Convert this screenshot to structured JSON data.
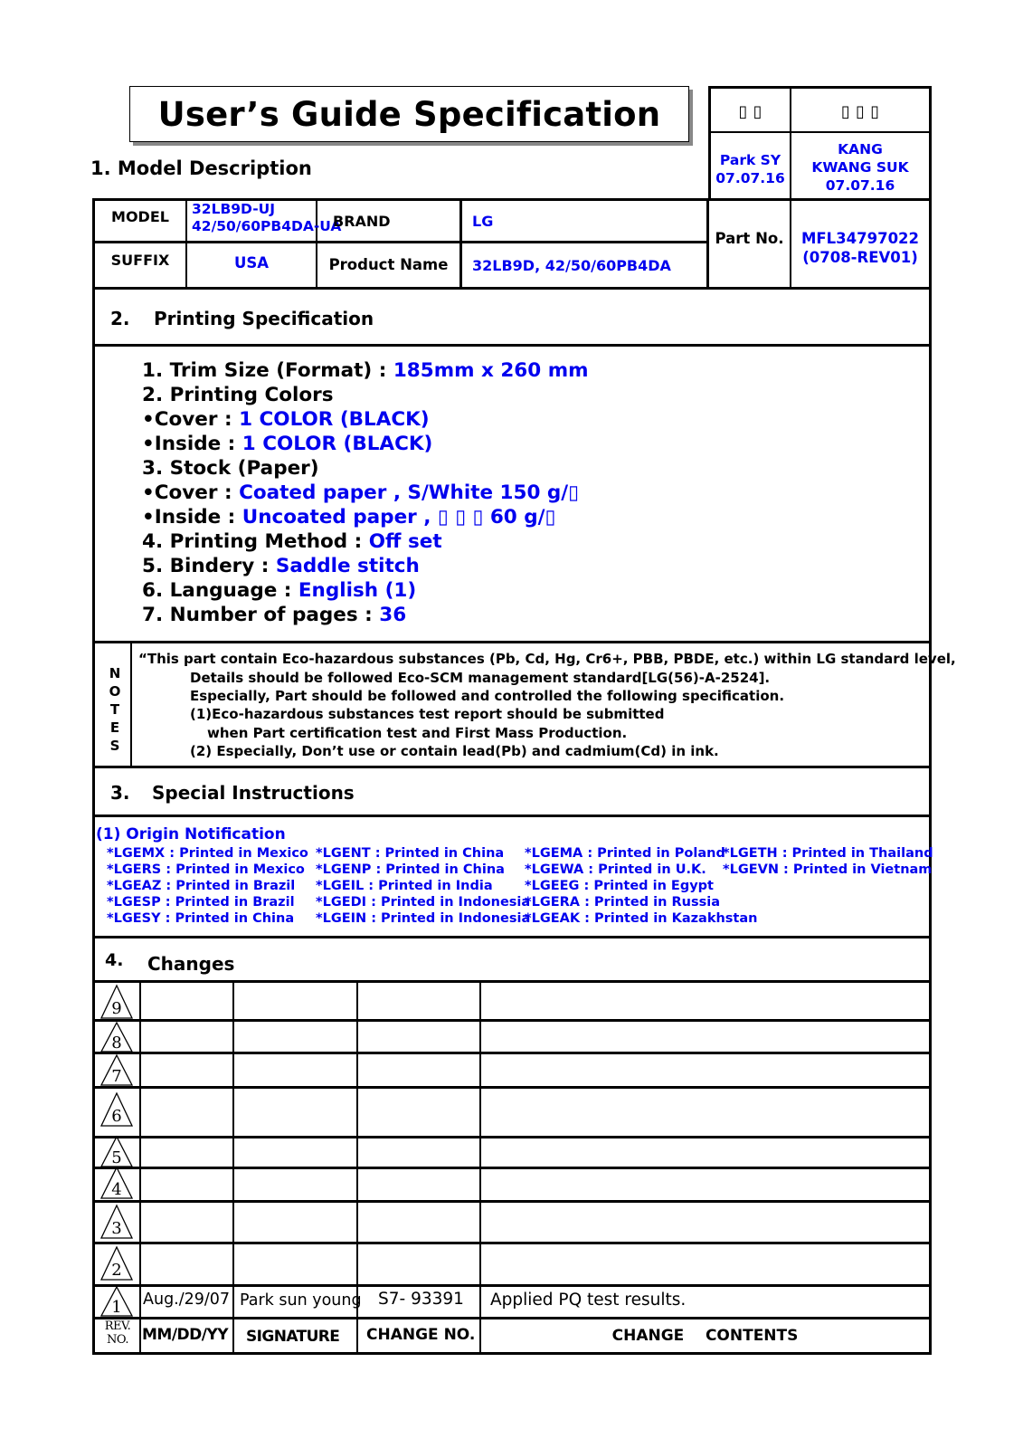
{
  "header": {
    "title": "User’s Guide Specification",
    "section1_label": "1. Model Description"
  },
  "approval": {
    "col1_heading_glyphs": "▯  ▯",
    "col2_heading_glyphs": "▯  ▯  ▯",
    "col1_name": "Park SY",
    "col1_date": "07.07.16",
    "col2_name_line1": "KANG",
    "col2_name_line2": "KWANG SUK",
    "col2_date": "07.07.16"
  },
  "model_table": {
    "model_label": "MODEL",
    "model_value_line1": "32LB9D-UJ",
    "model_value_line2": "42/50/60PB4DA-UA",
    "brand_label": "BRAND",
    "brand_value": "LG",
    "suffix_label": "SUFFIX",
    "suffix_value": "USA",
    "product_name_label": "Product Name",
    "product_name_value": "32LB9D, 42/50/60PB4DA",
    "part_no_label": "Part No.",
    "part_no_line1": "MFL34797022",
    "part_no_line2": "(0708-REV01)"
  },
  "printing": {
    "section_num": "2.",
    "section_title": "Printing Specification",
    "items": [
      {
        "label": "1. Trim Size (Format) : ",
        "value": "185mm x 260 mm"
      },
      {
        "label": "2. Printing Colors",
        "value": ""
      },
      {
        "label": "•Cover : ",
        "value": "1 COLOR (BLACK)"
      },
      {
        "label": "•Inside : ",
        "value": "1 COLOR (BLACK)"
      },
      {
        "label": "3. Stock (Paper)",
        "value": ""
      },
      {
        "label": "•Cover : ",
        "value": "Coated paper , S/White 150 g/▯"
      },
      {
        "label": "•Inside : ",
        "value": "Uncoated paper , ▯ ▯ ▯   60 g/▯"
      },
      {
        "label": "4. Printing Method : ",
        "value": "Off set"
      },
      {
        "label": "5. Bindery  : ",
        "value": "Saddle stitch"
      },
      {
        "label": "6. Language : ",
        "value": "English (1)"
      },
      {
        "label": "7. Number of pages : ",
        "value": "36"
      }
    ]
  },
  "notes": {
    "side_label_letters": [
      "N",
      "O",
      "T",
      "E",
      "S"
    ],
    "lines": [
      "“This part contain Eco-hazardous substances (Pb, Cd, Hg, Cr6+, PBB, PBDE, etc.) within LG standard level,",
      "Details should be followed Eco-SCM management standard[LG(56)-A-2524].",
      "Especially, Part should be followed and controlled the following specification.",
      "(1)Eco-hazardous substances test report should be submitted",
      "when  Part certification test and First Mass Production.",
      "(2) Especially, Don’t use or contain lead(Pb) and cadmium(Cd) in ink."
    ]
  },
  "special": {
    "section_num": "3.",
    "section_title": "Special Instructions",
    "origin_title": "(1) Origin Notification",
    "origin_columns": [
      [
        "*LGEMX : Printed in Mexico",
        "*LGERS : Printed in Mexico",
        "*LGEAZ : Printed in Brazil",
        "*LGESP : Printed in Brazil",
        "*LGESY : Printed in China"
      ],
      [
        "*LGENT : Printed in China",
        "*LGENP : Printed in China",
        "*LGEIL : Printed in India",
        "*LGEDI : Printed in Indonesia",
        "*LGEIN : Printed in Indonesia"
      ],
      [
        "*LGEMA : Printed in Poland",
        "*LGEWA : Printed in U.K.",
        "*LGEEG : Printed in Egypt",
        "*LGERA : Printed in Russia",
        "*LGEAK : Printed in Kazakhstan"
      ],
      [
        "*LGETH : Printed in Thailand",
        "*LGEVN : Printed in Vietnam"
      ]
    ]
  },
  "changes": {
    "section_num": "4.",
    "section_title": "Changes",
    "rows": [
      {
        "rev": "9",
        "date": "",
        "signature": "",
        "change_no": "",
        "contents": ""
      },
      {
        "rev": "8",
        "date": "",
        "signature": "",
        "change_no": "",
        "contents": ""
      },
      {
        "rev": "7",
        "date": "",
        "signature": "",
        "change_no": "",
        "contents": ""
      },
      {
        "rev": "6",
        "date": "",
        "signature": "",
        "change_no": "",
        "contents": ""
      },
      {
        "rev": "5",
        "date": "",
        "signature": "",
        "change_no": "",
        "contents": ""
      },
      {
        "rev": "4",
        "date": "",
        "signature": "",
        "change_no": "",
        "contents": ""
      },
      {
        "rev": "3",
        "date": "",
        "signature": "",
        "change_no": "",
        "contents": ""
      },
      {
        "rev": "2",
        "date": "",
        "signature": "",
        "change_no": "",
        "contents": ""
      },
      {
        "rev": "1",
        "date": "Aug./29/07",
        "signature": "Park sun young",
        "change_no": "S7- 93391",
        "contents": "Applied PQ test results."
      }
    ],
    "footer": {
      "rev_label_line1": "REV.",
      "rev_label_line2": "NO.",
      "date_label": "MM/DD/YY",
      "signature_label": "SIGNATURE",
      "change_no_label": "CHANGE NO.",
      "contents_label": "CHANGE    CONTENTS"
    }
  },
  "colors": {
    "value_blue": "#0000ee",
    "border": "#000000",
    "shadow": "#888888"
  }
}
